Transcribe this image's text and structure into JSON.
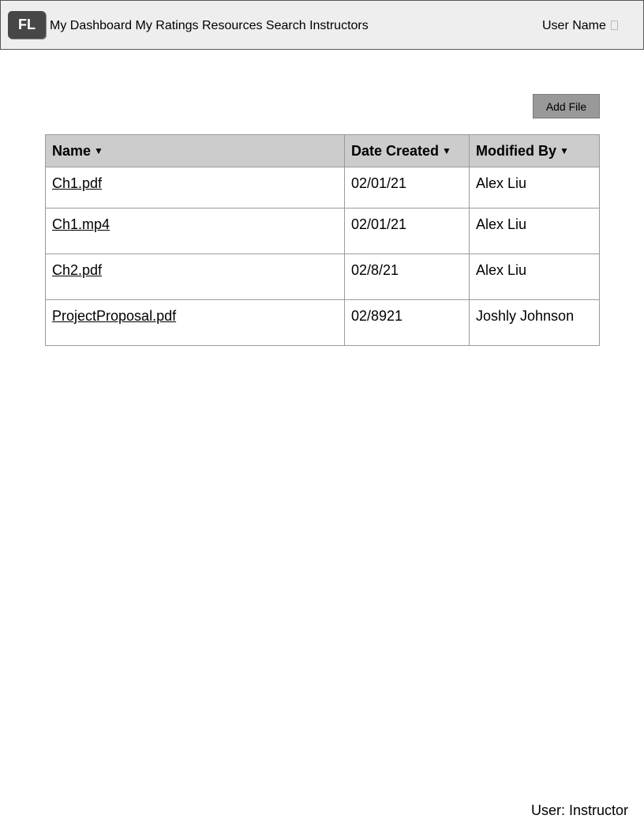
{
  "header": {
    "logo": "FL",
    "nav": [
      "My Dashboard",
      "My Ratings",
      "Resources",
      "Search Instructors"
    ],
    "user_name": "User Name"
  },
  "toolbar": {
    "add_file_label": "Add File"
  },
  "table": {
    "columns": [
      "Name",
      "Date Created",
      "Modified By"
    ],
    "sort_glyph": "▼",
    "rows": [
      {
        "name": "Ch1.pdf",
        "date_created": "02/01/21",
        "modified_by": "Alex Liu"
      },
      {
        "name": "Ch1.mp4",
        "date_created": "02/01/21",
        "modified_by": "Alex Liu"
      },
      {
        "name": "Ch2.pdf",
        "date_created": "02/8/21",
        "modified_by": "Alex Liu"
      },
      {
        "name": "ProjectProposal.pdf",
        "date_created": "02/8921",
        "modified_by": "Joshly Johnson"
      }
    ]
  },
  "footer": {
    "role": "User: Instructor"
  },
  "colors": {
    "header_bg": "#eeeeee",
    "logo_bg": "#474747",
    "button_bg": "#999999",
    "table_header_bg": "#cccccc"
  }
}
